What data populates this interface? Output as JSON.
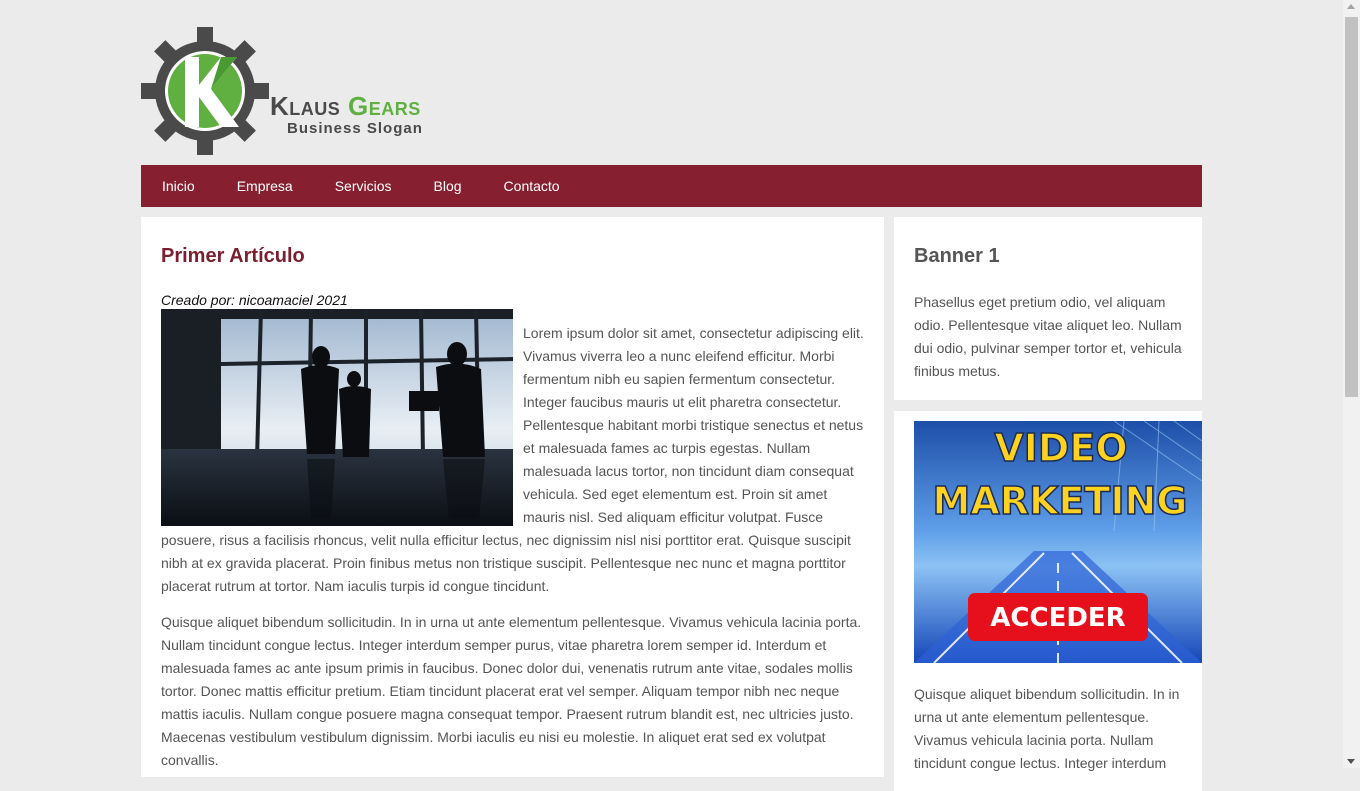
{
  "logo": {
    "name_part1": "Klaus",
    "name_part2": "Gears",
    "slogan": "Business Slogan",
    "icon": "gear-k-logo-icon"
  },
  "nav": {
    "items": [
      {
        "label": "Inicio"
      },
      {
        "label": "Empresa"
      },
      {
        "label": "Servicios"
      },
      {
        "label": "Blog"
      },
      {
        "label": "Contacto"
      }
    ]
  },
  "article": {
    "title": "Primer Artículo",
    "byline": "Creado por: nicoamaciel 2021",
    "paragraph1": "Lorem ipsum dolor sit amet, consectetur adipiscing elit. Vivamus viverra leo a nunc eleifend efficitur. Morbi fermentum nibh eu sapien fermentum consectetur. Integer faucibus mauris ut elit pharetra consectetur. Pellentesque habitant morbi tristique senectus et netus et malesuada fames ac turpis egestas. Nullam malesuada lacus tortor, non tincidunt diam consequat vehicula. Sed eget elementum est. Proin sit amet mauris nisl. Sed aliquam efficitur volutpat. Fusce posuere, risus a facilisis rhoncus, velit nulla efficitur lectus, nec dignissim nisl nisi porttitor erat. Quisque suscipit nibh at ex gravida placerat. Proin finibus metus non tristique suscipit. Pellentesque nec nunc et magna porttitor placerat rutrum at tortor. Nam iaculis turpis id congue tincidunt.",
    "paragraph2": "Quisque aliquet bibendum sollicitudin. In in urna ut ante elementum pellentesque. Vivamus vehicula lacinia porta. Nullam tincidunt congue lectus. Integer interdum semper purus, vitae pharetra lorem semper id. Interdum et malesuada fames ac ante ipsum primis in faucibus. Donec dolor dui, venenatis rutrum ante vitae, sodales mollis tortor. Donec mattis efficitur pretium. Etiam tincidunt placerat erat vel semper. Aliquam tempor nibh nec neque mattis iaculis. Nullam congue posuere magna consequat tempor. Praesent rutrum blandit est, nec ultricies justo. Maecenas vestibulum vestibulum dignissim. Morbi iaculis eu nisi eu molestie. In aliquet erat sed ex volutpat convallis."
  },
  "sidebar": {
    "banner1_title": "Banner 1",
    "banner1_text": "Phasellus eget pretium odio, vel aliquam odio. Pellentesque vitae aliquet leo. Nullam dui odio, pulvinar semper tortor et, vehicula finibus metus.",
    "video_banner": {
      "line1": "VIDEO",
      "line2": "MARKETING",
      "button": "ACCEDER"
    },
    "banner2_text": "Quisque aliquet bibendum sollicitudin. In in urna ut ante elementum pellentesque. Vivamus vehicula lacinia porta. Nullam tincidunt congue lectus. Integer interdum"
  },
  "colors": {
    "nav_bg": "#862031",
    "title_red": "#7a1f2e",
    "logo_green": "#5fb041",
    "logo_gray": "#4a4a4a",
    "page_bg": "#ebebeb"
  }
}
